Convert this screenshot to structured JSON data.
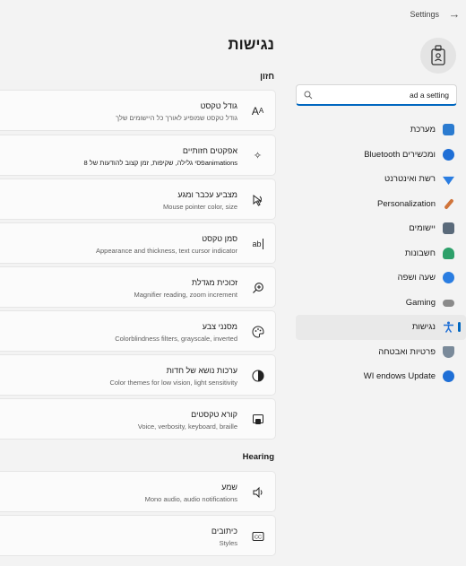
{
  "app": {
    "title": "Settings"
  },
  "sidebar": {
    "search_value": "ad a setting",
    "items": [
      {
        "label": "מערכת",
        "icon": "system-icon",
        "color": "#2b7bd0"
      },
      {
        "label": "Bluetooth ומכשירים",
        "icon": "bluetooth-icon",
        "color": "#1f6fd6"
      },
      {
        "label": "רשת ואינטרנט",
        "icon": "wifi-icon",
        "color": "#2a7de1"
      },
      {
        "label": "Personalization",
        "icon": "paint-brush-icon",
        "color": "#d0743a"
      },
      {
        "label": "יישומים",
        "icon": "apps-icon",
        "color": "#5a6a7a"
      },
      {
        "label": "חשבונות",
        "icon": "accounts-icon",
        "color": "#2da06a"
      },
      {
        "label": "שעה ושפה",
        "icon": "time-language-icon",
        "color": "#2a7de1"
      },
      {
        "label": "Gaming",
        "icon": "gaming-icon",
        "color": "#8a8a8a"
      },
      {
        "label": "נגישות",
        "icon": "accessibility-icon",
        "color": "#1f6fd6",
        "active": true
      },
      {
        "label": "פרטיות ואבטחה",
        "icon": "shield-icon",
        "color": "#7a8a9a"
      },
      {
        "label": "WI endows Update",
        "icon": "windows-update-icon",
        "color": "#1f6fd6"
      }
    ]
  },
  "main": {
    "title": "נגישות",
    "sections": [
      {
        "title": "חזון"
      },
      {
        "title": "Hearing"
      }
    ],
    "cards": [
      {
        "title": "גודל טקסט",
        "subtitle": "גודל טקסט שמופיע לאורך כל היישומים שלך",
        "icon": "text-size-icon"
      },
      {
        "title": "אפקטים חזותיים",
        "subtitle": "פסי גלילה, שקיפות, זמן קצוב להודעות של 8animations",
        "icon": "sparkle-icon"
      },
      {
        "title": "מצביע עכבר ומגע",
        "subtitle": "Mouse pointer color, size",
        "icon": "mouse-pointer-icon"
      },
      {
        "title": "סמן טקסט",
        "subtitle": "Appearance and thickness, text cursor indicator",
        "icon": "text-cursor-icon"
      },
      {
        "title": "זכוכית מגדלת",
        "subtitle": "Magnifier reading, zoom increment",
        "icon": "magnifier-icon"
      },
      {
        "title": "מסנני צבע",
        "subtitle": "Colorblindness filters, grayscale, inverted",
        "icon": "palette-icon"
      },
      {
        "title": "ערכות נושא של חדות",
        "subtitle": "Color themes for low vision, light sensitivity",
        "icon": "contrast-icon"
      },
      {
        "title": "קורא טקסטים",
        "subtitle": "Voice, verbosity, keyboard, braille",
        "icon": "narrator-icon"
      },
      {
        "title": "שמע",
        "subtitle": "Mono audio, audio notifications",
        "icon": "audio-icon"
      },
      {
        "title": "כיתובים",
        "subtitle": "Styles",
        "icon": "captions-icon"
      }
    ]
  }
}
